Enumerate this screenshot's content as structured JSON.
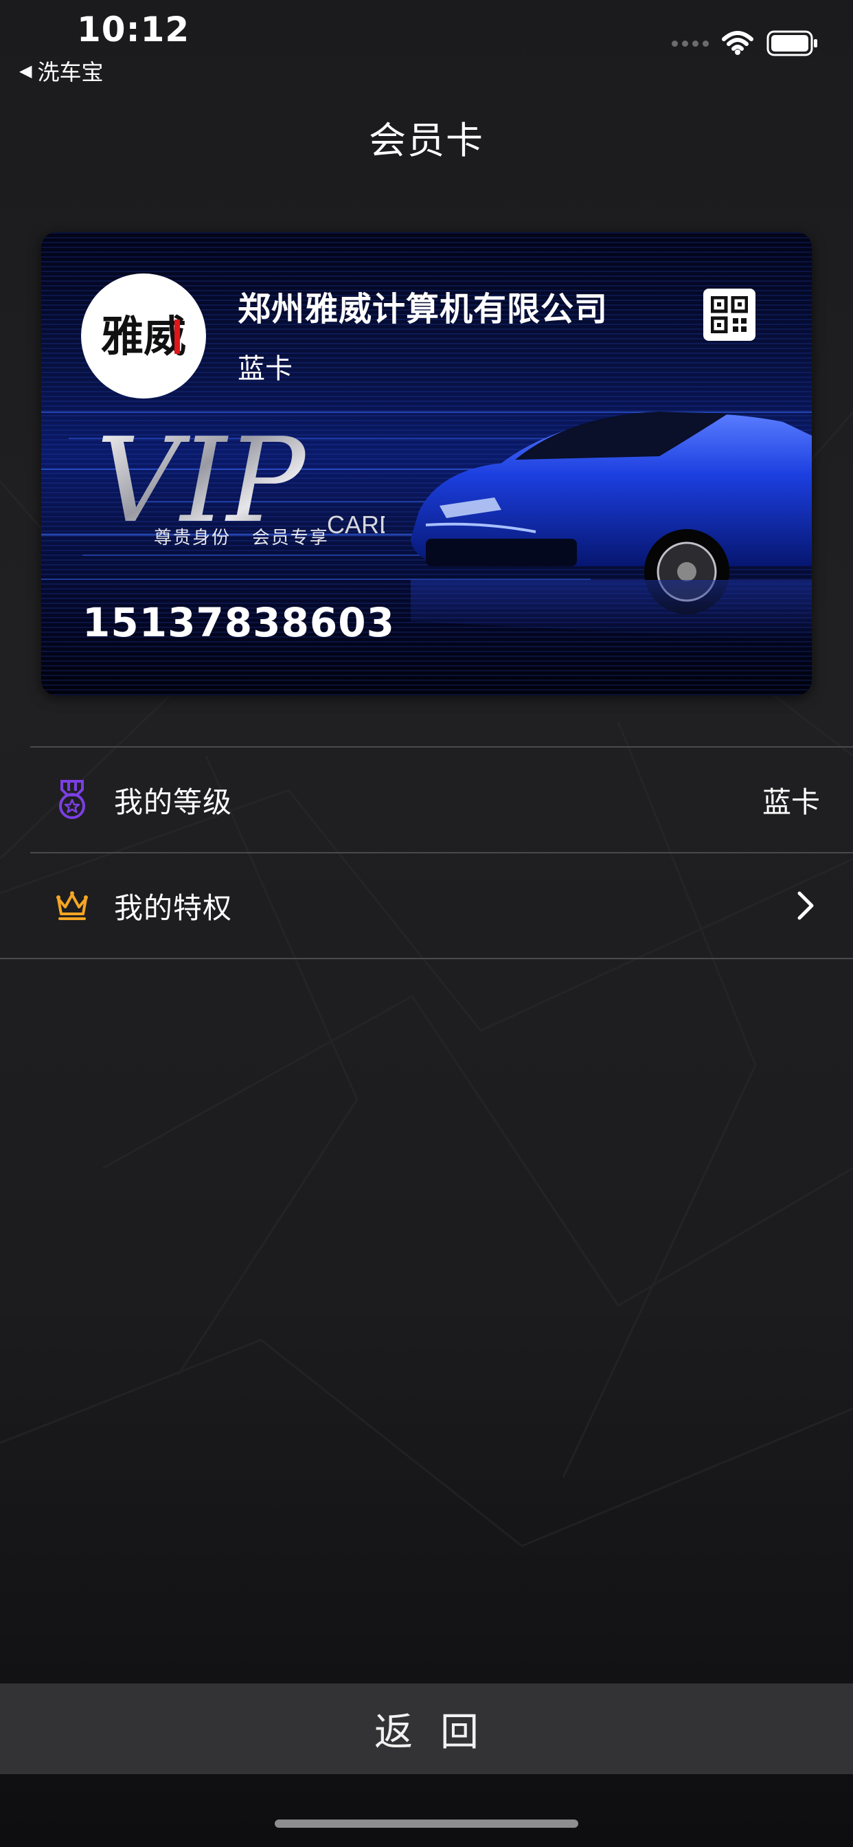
{
  "status_bar": {
    "time": "10:12",
    "back_app_arrow": "◀",
    "back_app_label": "洗车宝",
    "icons": [
      "signal-dots-icon",
      "wifi-icon",
      "battery-icon"
    ]
  },
  "header": {
    "title": "会员卡"
  },
  "card": {
    "logo_text": "雅威",
    "company_name": "郑州雅威计算机有限公司",
    "level": "蓝卡",
    "vip_big": "VIP",
    "vip_small": "CARD",
    "tagline": "尊贵身份   会员专享",
    "member_number": "15137838603",
    "qr_icon": "qr-code-icon"
  },
  "list": {
    "rows": [
      {
        "icon": "medal-icon",
        "label": "我的等级",
        "value": "蓝卡"
      },
      {
        "icon": "crown-icon",
        "label": "我的特权",
        "value": ""
      }
    ]
  },
  "footer": {
    "return_label": "返回"
  },
  "colors": {
    "background": "#1c1c1e",
    "medal_icon": "#7b3fe4",
    "crown_icon": "#f5a623",
    "divider": "#4a4a4c",
    "return_bar": "#333335",
    "card_blue": "#0a1a6a"
  }
}
